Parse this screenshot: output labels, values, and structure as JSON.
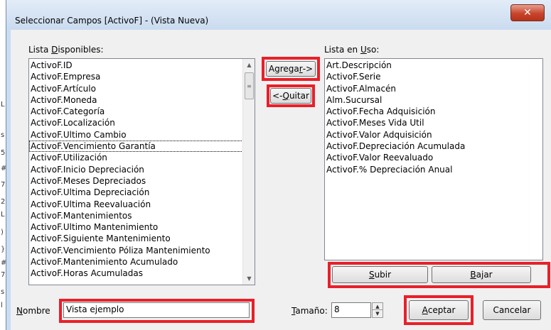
{
  "window": {
    "title": "Seleccionar Campos [ActivoF] - (Vista Nueva)",
    "close_icon": "close-icon"
  },
  "available": {
    "label_pre": "Lista ",
    "label_key": "D",
    "label_post": "isponibles:",
    "items": [
      "ActivoF.ID",
      "ActivoF.Empresa",
      "ActivoF.Artículo",
      "ActivoF.Moneda",
      "ActivoF.Categoría",
      "ActivoF.Localización",
      "ActivoF.Ultimo Cambio",
      "ActivoF.Vencimiento Garantía",
      "ActivoF.Utilización",
      "ActivoF.Inicio Depreciación",
      "ActivoF.Meses Depreciados",
      "ActivoF.Ultima Depreciación",
      "ActivoF.Ultima Reevaluación",
      "ActivoF.Mantenimientos",
      "ActivoF.Ultimo Mantenimiento",
      "ActivoF.Siguiente Mantenimiento",
      "ActivoF.Vencimiento Póliza Mantenimiento",
      "ActivoF.Mantenimiento Acumulado",
      "ActivoF.Horas Acumuladas"
    ]
  },
  "in_use": {
    "label_pre": "Lista en ",
    "label_key": "U",
    "label_post": "so:",
    "items": [
      "Art.Descripción",
      "ActivoF.Serie",
      "ActivoF.Almacén",
      "Alm.Sucursal",
      "ActivoF.Fecha Adquisición",
      "ActivoF.Meses Vida Util",
      "ActivoF.Valor Adquisición",
      "ActivoF.Depreciación Acumulada",
      "ActivoF.Valor Reevaluado",
      "ActivoF.% Depreciación Anual"
    ]
  },
  "buttons": {
    "add_pre": "Agrega",
    "add_key": "r",
    "add_post": " ->",
    "remove_pre": "<- ",
    "remove_key": "Q",
    "remove_post": "uitar",
    "up_key": "S",
    "up_post": "ubir",
    "down_key": "B",
    "down_post": "ajar",
    "accept_key": "A",
    "accept_post": "ceptar",
    "cancel": "Cancelar"
  },
  "name": {
    "label_key": "N",
    "label_post": "ombre",
    "value": "Vista ejemplo"
  },
  "size": {
    "label_key": "T",
    "label_post": "amaño:",
    "value": "8"
  },
  "colors": {
    "highlight": "#e8202a"
  }
}
